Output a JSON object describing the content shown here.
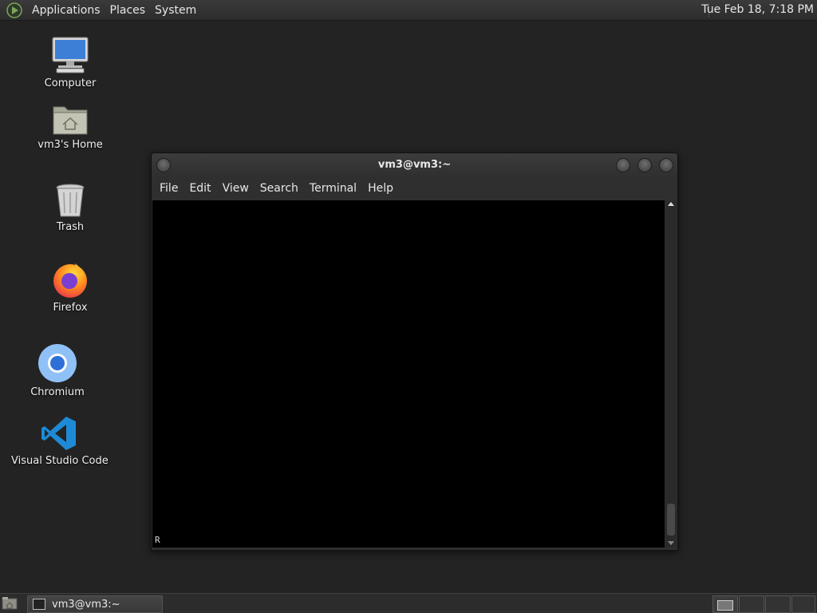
{
  "top_panel": {
    "menus": [
      "Applications",
      "Places",
      "System"
    ],
    "clock": "Tue Feb 18,  7:18 PM"
  },
  "desktop_icons": [
    {
      "label": "Computer",
      "icon": "computer-icon"
    },
    {
      "label": "vm3's Home",
      "icon": "home-folder-icon"
    },
    {
      "label": "Trash",
      "icon": "trash-icon"
    },
    {
      "label": "Firefox",
      "icon": "firefox-icon"
    },
    {
      "label": "Chromium",
      "icon": "chromium-icon"
    },
    {
      "label": "Visual Studio Code",
      "icon": "vscode-icon"
    }
  ],
  "terminal": {
    "title": "vm3@vm3:~",
    "menu": [
      "File",
      "Edit",
      "View",
      "Search",
      "Terminal",
      "Help"
    ],
    "content": "R"
  },
  "taskbar": {
    "task_label": "vm3@vm3:~"
  }
}
